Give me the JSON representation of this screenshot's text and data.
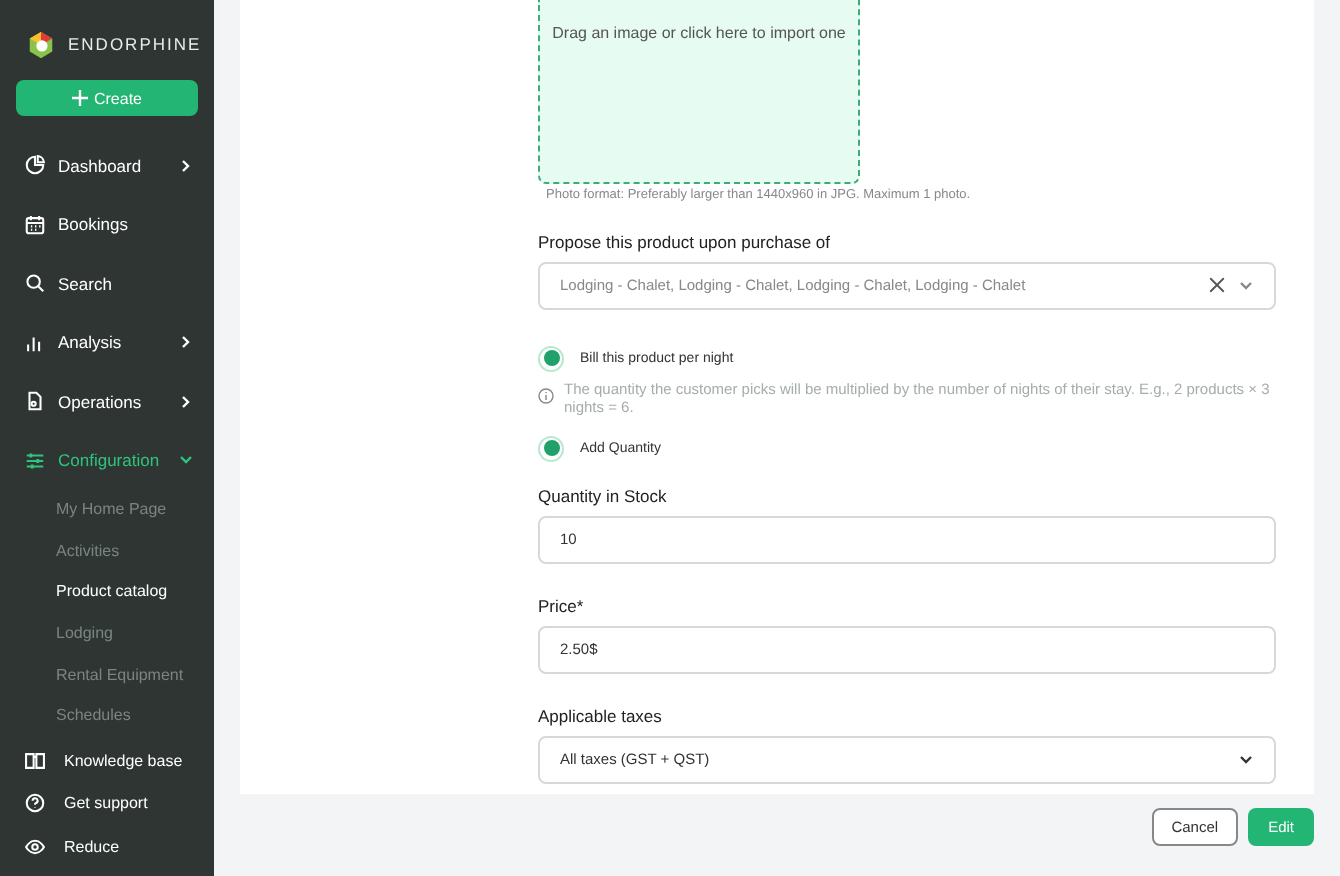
{
  "sidebar": {
    "brand": "ENDORPHINE",
    "create_button": "Create",
    "items": [
      {
        "label": "Dashboard",
        "kind": "group",
        "expanded": false
      },
      {
        "label": "Bookings",
        "kind": "link"
      },
      {
        "label": "Search",
        "kind": "link"
      },
      {
        "label": "Analysis",
        "kind": "group",
        "expanded": false
      },
      {
        "label": "Operations",
        "kind": "group",
        "expanded": false
      },
      {
        "label": "Configuration",
        "kind": "group",
        "expanded": true,
        "children": [
          {
            "label": "My Home Page",
            "selected": false
          },
          {
            "label": "Activities",
            "selected": false
          },
          {
            "label": "Product catalog",
            "selected": true
          },
          {
            "label": "Lodging",
            "selected": false
          },
          {
            "label": "Rental Equipment",
            "selected": false
          },
          {
            "label": "Schedules",
            "selected": false
          }
        ]
      }
    ],
    "footer": [
      {
        "label": "Knowledge base"
      },
      {
        "label": "Get support"
      },
      {
        "label": "Reduce"
      }
    ]
  },
  "form": {
    "dropzone": "Drag an image or click here to import one",
    "photo_note": "Photo format: Preferably larger than 1440x960 in JPG. Maximum 1 photo.",
    "propose": {
      "label": "Propose this product upon purchase of",
      "value": "Lodging - Chalet, Lodging - Chalet, Lodging - Chalet, Lodging - Chalet"
    },
    "bill_per_night": {
      "label": "Bill this product per night",
      "checked": true
    },
    "info": "The quantity the customer picks will be multiplied by the number of nights of their stay. E.g., 2 products × 3 nights = 6.",
    "add_quantity": {
      "label": "Add Quantity",
      "checked": true
    },
    "stock": {
      "label": "Quantity in Stock",
      "value": "10"
    },
    "price": {
      "label": "Price*",
      "value": "2.50$"
    },
    "taxes": {
      "label": "Applicable taxes",
      "value": "All taxes (GST + QST)"
    }
  },
  "buttons": {
    "cancel": "Cancel",
    "edit": "Edit"
  }
}
